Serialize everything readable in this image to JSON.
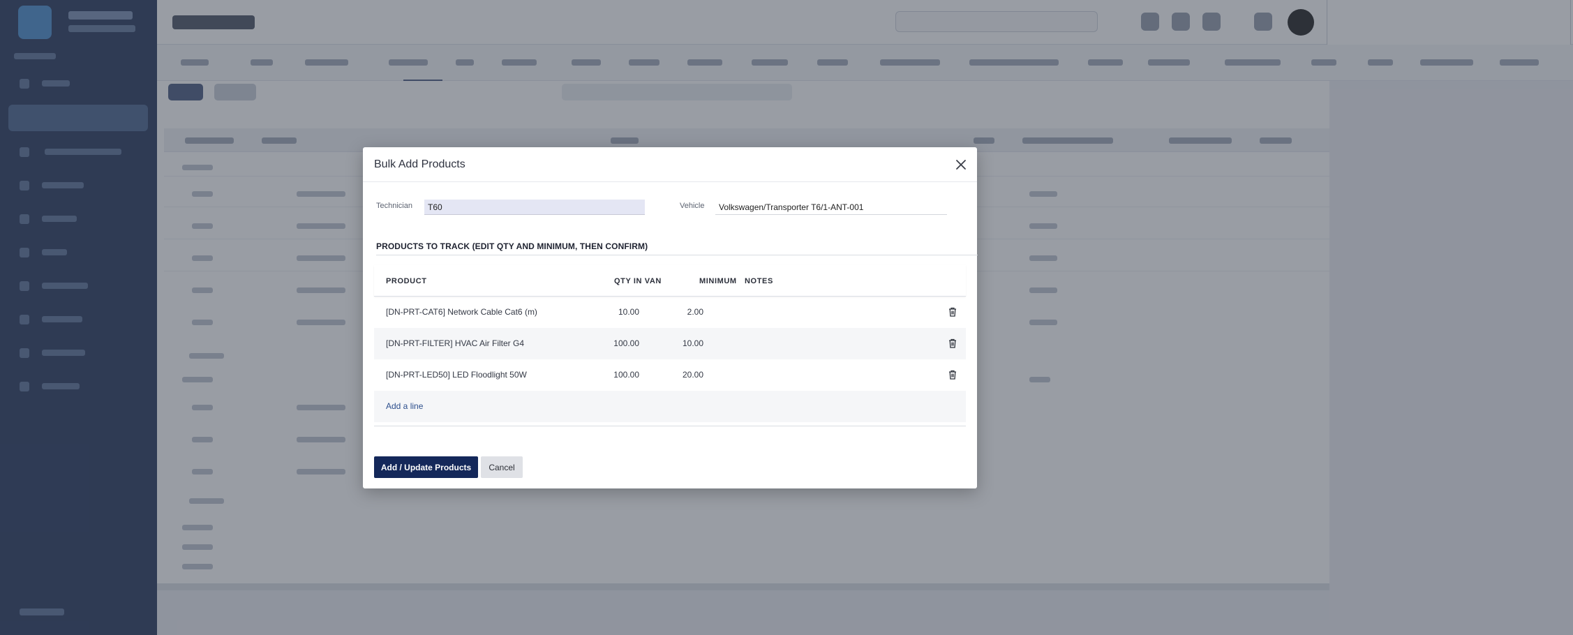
{
  "modal": {
    "title": "Bulk Add Products",
    "technician_label": "Technician",
    "technician_value": "T60",
    "vehicle_label": "Vehicle",
    "vehicle_value": "Volkswagen/Transporter T6/1-ANT-001",
    "section_title": "PRODUCTS TO TRACK (EDIT QTY AND MINIMUM, THEN CONFIRM)",
    "columns": {
      "product": "PRODUCT",
      "qty": "QTY IN VAN",
      "minimum": "MINIMUM",
      "notes": "NOTES"
    },
    "rows": [
      {
        "product": "[DN-PRT-CAT6] Network Cable Cat6 (m)",
        "qty": "10.00",
        "minimum": "2.00",
        "notes": ""
      },
      {
        "product": "[DN-PRT-FILTER] HVAC Air Filter G4",
        "qty": "100.00",
        "minimum": "10.00",
        "notes": ""
      },
      {
        "product": "[DN-PRT-LED50] LED Floodlight 50W",
        "qty": "100.00",
        "minimum": "20.00",
        "notes": ""
      }
    ],
    "add_line_label": "Add a line",
    "confirm_label": "Add / Update Products",
    "cancel_label": "Cancel"
  },
  "colors": {
    "sidebar": "#14264f",
    "primary_button": "#14285a",
    "link": "#2c4e8c",
    "technician_field_bg": "#e4e6f4"
  },
  "icons": [
    "close-icon",
    "trash-icon"
  ]
}
